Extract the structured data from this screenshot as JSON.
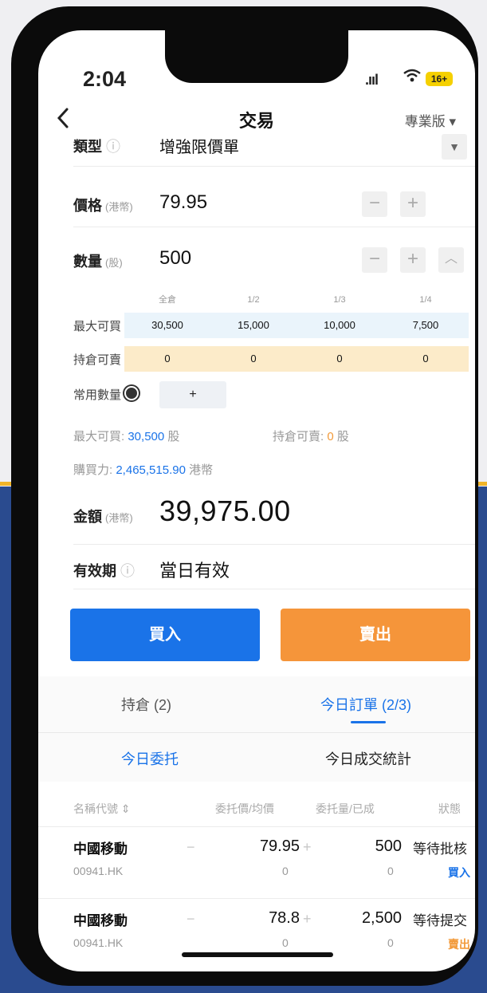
{
  "colors": {
    "buy": "#1a73e8",
    "sell": "#f5953a",
    "accent": "#1a73e8",
    "background_blue": "#2a4b8f",
    "highlight_yellow": "#f0b429"
  },
  "status_bar": {
    "time": "2:04",
    "signal": ".ııl",
    "battery": "16+"
  },
  "nav": {
    "back_icon": "chevron-left-icon",
    "title": "交易",
    "mode": "專業版 ▾"
  },
  "form": {
    "type": {
      "label": "類型",
      "value": "增強限價單"
    },
    "price": {
      "label": "價格",
      "unit": "(港幣)",
      "value": "79.95"
    },
    "quantity": {
      "label": "數量",
      "unit": "(股)",
      "value": "500"
    },
    "quick_qty": {
      "headers": [
        "全倉",
        "1/2",
        "1/3",
        "1/4"
      ],
      "max_buy_label": "最大可買",
      "max_buy": [
        "30,500",
        "15,000",
        "10,000",
        "7,500"
      ],
      "hold_sell_label": "持倉可賣",
      "hold_sell": [
        "0",
        "0",
        "0",
        "0"
      ],
      "common_label": "常用數量",
      "common_add": "+"
    },
    "max_buy_info": {
      "label": "最大可買:",
      "value": "30,500",
      "unit": "股"
    },
    "hold_sell_info": {
      "label": "持倉可賣:",
      "value": "0",
      "unit": "股"
    },
    "buying_power": {
      "label": "購買力:",
      "value": "2,465,515.90",
      "unit": "港幣"
    },
    "amount": {
      "label": "金額",
      "unit": "(港幣)",
      "value": "39,975.00"
    },
    "validity": {
      "label": "有效期",
      "value": "當日有效"
    }
  },
  "actions": {
    "buy": "買入",
    "sell": "賣出"
  },
  "tabs": {
    "positions": "持倉 (2)",
    "orders": "今日訂單 (2/3)"
  },
  "subtabs": {
    "entrust": "今日委托",
    "filled_stats": "今日成交統計"
  },
  "table": {
    "headers": {
      "name": "名稱代號 ⇕",
      "price": "委托價/均價",
      "qty": "委托量/已成",
      "status": "狀態"
    },
    "rows": [
      {
        "name": "中國移動",
        "code": "00941.HK",
        "price": "79.95",
        "avg": "0",
        "qty": "500",
        "filled": "0",
        "status": "等待批核",
        "side": "買入"
      },
      {
        "name": "中國移動",
        "code": "00941.HK",
        "price": "78.8",
        "avg": "0",
        "qty": "2,500",
        "filled": "0",
        "status": "等待提交",
        "side": "賣出"
      }
    ]
  }
}
